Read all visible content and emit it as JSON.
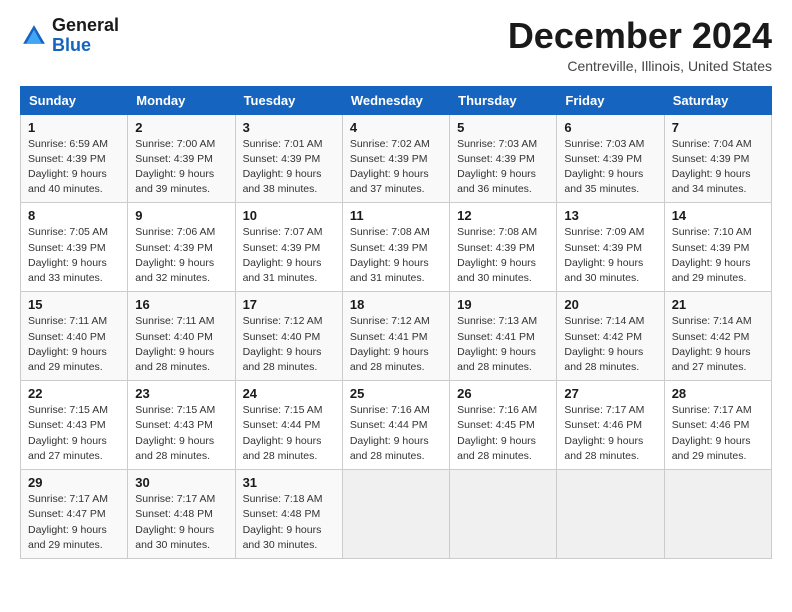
{
  "logo": {
    "line1": "General",
    "line2": "Blue"
  },
  "title": "December 2024",
  "location": "Centreville, Illinois, United States",
  "days_of_week": [
    "Sunday",
    "Monday",
    "Tuesday",
    "Wednesday",
    "Thursday",
    "Friday",
    "Saturday"
  ],
  "weeks": [
    [
      {
        "day": "1",
        "sunrise": "6:59 AM",
        "sunset": "4:39 PM",
        "daylight": "9 hours and 40 minutes."
      },
      {
        "day": "2",
        "sunrise": "7:00 AM",
        "sunset": "4:39 PM",
        "daylight": "9 hours and 39 minutes."
      },
      {
        "day": "3",
        "sunrise": "7:01 AM",
        "sunset": "4:39 PM",
        "daylight": "9 hours and 38 minutes."
      },
      {
        "day": "4",
        "sunrise": "7:02 AM",
        "sunset": "4:39 PM",
        "daylight": "9 hours and 37 minutes."
      },
      {
        "day": "5",
        "sunrise": "7:03 AM",
        "sunset": "4:39 PM",
        "daylight": "9 hours and 36 minutes."
      },
      {
        "day": "6",
        "sunrise": "7:03 AM",
        "sunset": "4:39 PM",
        "daylight": "9 hours and 35 minutes."
      },
      {
        "day": "7",
        "sunrise": "7:04 AM",
        "sunset": "4:39 PM",
        "daylight": "9 hours and 34 minutes."
      }
    ],
    [
      {
        "day": "8",
        "sunrise": "7:05 AM",
        "sunset": "4:39 PM",
        "daylight": "9 hours and 33 minutes."
      },
      {
        "day": "9",
        "sunrise": "7:06 AM",
        "sunset": "4:39 PM",
        "daylight": "9 hours and 32 minutes."
      },
      {
        "day": "10",
        "sunrise": "7:07 AM",
        "sunset": "4:39 PM",
        "daylight": "9 hours and 31 minutes."
      },
      {
        "day": "11",
        "sunrise": "7:08 AM",
        "sunset": "4:39 PM",
        "daylight": "9 hours and 31 minutes."
      },
      {
        "day": "12",
        "sunrise": "7:08 AM",
        "sunset": "4:39 PM",
        "daylight": "9 hours and 30 minutes."
      },
      {
        "day": "13",
        "sunrise": "7:09 AM",
        "sunset": "4:39 PM",
        "daylight": "9 hours and 30 minutes."
      },
      {
        "day": "14",
        "sunrise": "7:10 AM",
        "sunset": "4:39 PM",
        "daylight": "9 hours and 29 minutes."
      }
    ],
    [
      {
        "day": "15",
        "sunrise": "7:11 AM",
        "sunset": "4:40 PM",
        "daylight": "9 hours and 29 minutes."
      },
      {
        "day": "16",
        "sunrise": "7:11 AM",
        "sunset": "4:40 PM",
        "daylight": "9 hours and 28 minutes."
      },
      {
        "day": "17",
        "sunrise": "7:12 AM",
        "sunset": "4:40 PM",
        "daylight": "9 hours and 28 minutes."
      },
      {
        "day": "18",
        "sunrise": "7:12 AM",
        "sunset": "4:41 PM",
        "daylight": "9 hours and 28 minutes."
      },
      {
        "day": "19",
        "sunrise": "7:13 AM",
        "sunset": "4:41 PM",
        "daylight": "9 hours and 28 minutes."
      },
      {
        "day": "20",
        "sunrise": "7:14 AM",
        "sunset": "4:42 PM",
        "daylight": "9 hours and 28 minutes."
      },
      {
        "day": "21",
        "sunrise": "7:14 AM",
        "sunset": "4:42 PM",
        "daylight": "9 hours and 27 minutes."
      }
    ],
    [
      {
        "day": "22",
        "sunrise": "7:15 AM",
        "sunset": "4:43 PM",
        "daylight": "9 hours and 27 minutes."
      },
      {
        "day": "23",
        "sunrise": "7:15 AM",
        "sunset": "4:43 PM",
        "daylight": "9 hours and 28 minutes."
      },
      {
        "day": "24",
        "sunrise": "7:15 AM",
        "sunset": "4:44 PM",
        "daylight": "9 hours and 28 minutes."
      },
      {
        "day": "25",
        "sunrise": "7:16 AM",
        "sunset": "4:44 PM",
        "daylight": "9 hours and 28 minutes."
      },
      {
        "day": "26",
        "sunrise": "7:16 AM",
        "sunset": "4:45 PM",
        "daylight": "9 hours and 28 minutes."
      },
      {
        "day": "27",
        "sunrise": "7:17 AM",
        "sunset": "4:46 PM",
        "daylight": "9 hours and 28 minutes."
      },
      {
        "day": "28",
        "sunrise": "7:17 AM",
        "sunset": "4:46 PM",
        "daylight": "9 hours and 29 minutes."
      }
    ],
    [
      {
        "day": "29",
        "sunrise": "7:17 AM",
        "sunset": "4:47 PM",
        "daylight": "9 hours and 29 minutes."
      },
      {
        "day": "30",
        "sunrise": "7:17 AM",
        "sunset": "4:48 PM",
        "daylight": "9 hours and 30 minutes."
      },
      {
        "day": "31",
        "sunrise": "7:18 AM",
        "sunset": "4:48 PM",
        "daylight": "9 hours and 30 minutes."
      },
      null,
      null,
      null,
      null
    ]
  ]
}
